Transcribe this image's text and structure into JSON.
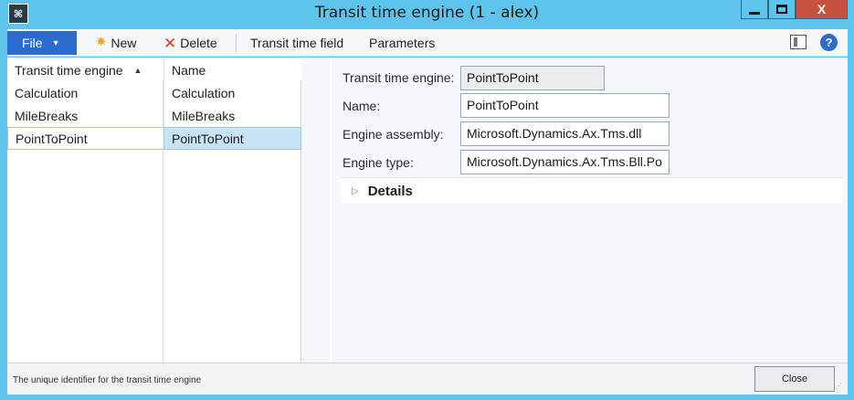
{
  "window": {
    "title": "Transit time engine (1 - alex)",
    "close_glyph": "X"
  },
  "toolbar": {
    "file_label": "File",
    "new_label": "New",
    "delete_label": "Delete",
    "transit_time_field_label": "Transit time field",
    "parameters_label": "Parameters",
    "help_glyph": "?"
  },
  "grid": {
    "columns": [
      "Transit time engine",
      "Name"
    ],
    "rows": [
      {
        "engine": "Calculation",
        "name": "Calculation",
        "selected": false
      },
      {
        "engine": "MileBreaks",
        "name": "MileBreaks",
        "selected": false
      },
      {
        "engine": "PointToPoint",
        "name": "PointToPoint",
        "selected": true
      }
    ]
  },
  "form": {
    "engine_label": "Transit time engine:",
    "engine_value": "PointToPoint",
    "name_label": "Name:",
    "name_value": "PointToPoint",
    "assembly_label": "Engine assembly:",
    "assembly_value": "Microsoft.Dynamics.Ax.Tms.dll",
    "type_label": "Engine type:",
    "type_value": "Microsoft.Dynamics.Ax.Tms.Bll.Po",
    "details_label": "Details"
  },
  "status": {
    "text": "The unique identifier for the transit time engine",
    "close_label": "Close"
  },
  "colors": {
    "frame": "#5ec4ec",
    "file_button": "#2a6bd0",
    "close_window": "#c7503f",
    "selected_row": "#c8e2f6"
  }
}
